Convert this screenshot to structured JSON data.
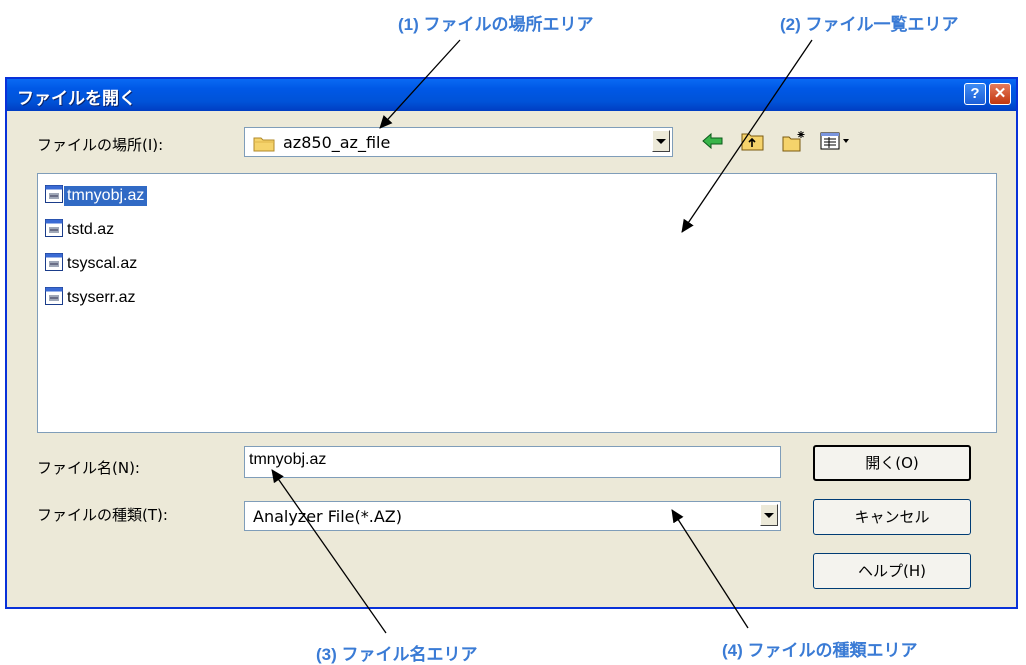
{
  "callouts": {
    "c1": "(1) ファイルの場所エリア",
    "c2": "(2) ファイル一覧エリア",
    "c3": "(3) ファイル名エリア",
    "c4": "(4) ファイルの種類エリア"
  },
  "dialog": {
    "title": "ファイルを開く",
    "help_glyph": "?",
    "close_glyph": "✕"
  },
  "location": {
    "label": "ファイルの場所(I):",
    "value": "az850_az_file"
  },
  "toolbar": {
    "icons": [
      "back-arrow-icon",
      "up-folder-icon",
      "new-folder-icon",
      "view-menu-icon"
    ]
  },
  "files": [
    {
      "name": "tmnyobj.az",
      "selected": true
    },
    {
      "name": "tstd.az",
      "selected": false
    },
    {
      "name": "tsyscal.az",
      "selected": false
    },
    {
      "name": "tsyserr.az",
      "selected": false
    }
  ],
  "filename": {
    "label": "ファイル名(N):",
    "value": "tmnyobj.az"
  },
  "filetype": {
    "label": "ファイルの種類(T):",
    "value": "Analyzer File(*.AZ)"
  },
  "buttons": {
    "open": "開く(O)",
    "cancel": "キャンセル",
    "help": "ヘルプ(H)"
  },
  "colors": {
    "callout": "#3a7bd5",
    "titlebar": "#0053d8",
    "selection": "#316ac5"
  }
}
